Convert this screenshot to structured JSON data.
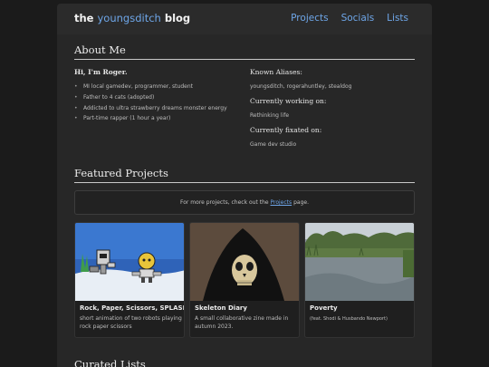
{
  "header": {
    "brand_prefix": "the",
    "brand_name": "youngsditch",
    "brand_suffix": "blog",
    "nav": [
      "Projects",
      "Socials",
      "Lists"
    ]
  },
  "about": {
    "title": "About Me",
    "greeting": "Hi, I'm Roger.",
    "bullets": [
      "MI local gamedev, programmer, student",
      "Father to 4 cats (adopted)",
      "Addicted to ultra strawberry dreams monster energy",
      "Part-time rapper (1 hour a year)"
    ],
    "aliases_heading": "Known Aliases:",
    "aliases_value": "youngsditch, rogerahuntley, stealdog",
    "working_heading": "Currently working on:",
    "working_value": "Rethinking life",
    "fixated_heading": "Currently fixated on:",
    "fixated_value": "Game dev studio"
  },
  "featured": {
    "title": "Featured Projects",
    "notice_before": "For more projects, check out the",
    "notice_link": "Projects",
    "notice_after": "page.",
    "cards": [
      {
        "title": "Rock, Paper, Scissors, SPLASH!",
        "desc": "short animation of two robots playing rock paper scissors"
      },
      {
        "title": "Skeleton Diary",
        "desc": "A small collaborative zine made in autumn 2023."
      },
      {
        "title": "Poverty",
        "desc": "(feat. Shodi & Husbando Newport)"
      }
    ]
  },
  "curated": {
    "title": "Curated Lists"
  },
  "colors": {
    "accent": "#6ea6e8",
    "background": "#1b1b1b",
    "panel": "#272727"
  }
}
